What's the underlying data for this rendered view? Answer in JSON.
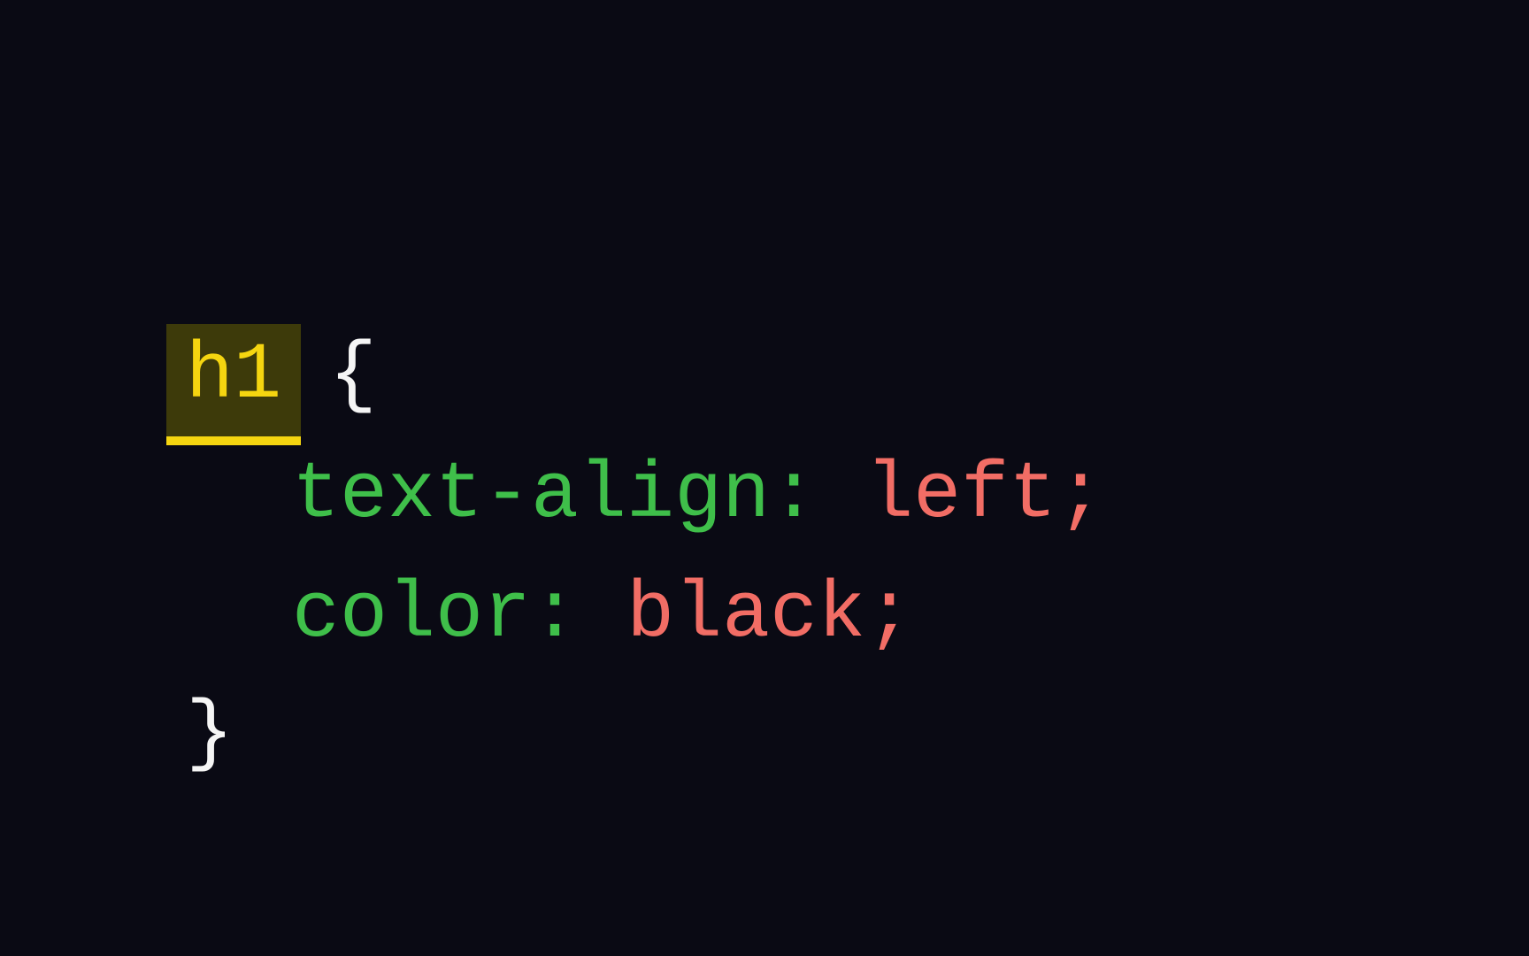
{
  "code": {
    "selector": "h1",
    "brace_open": "{",
    "brace_close": "}",
    "line1": {
      "property": "text-align",
      "colon": ":",
      "space": " ",
      "value": "left",
      "semicolon": ";"
    },
    "line2": {
      "property": "color",
      "colon": ":",
      "space": " ",
      "value": "black",
      "semicolon": ";"
    }
  }
}
